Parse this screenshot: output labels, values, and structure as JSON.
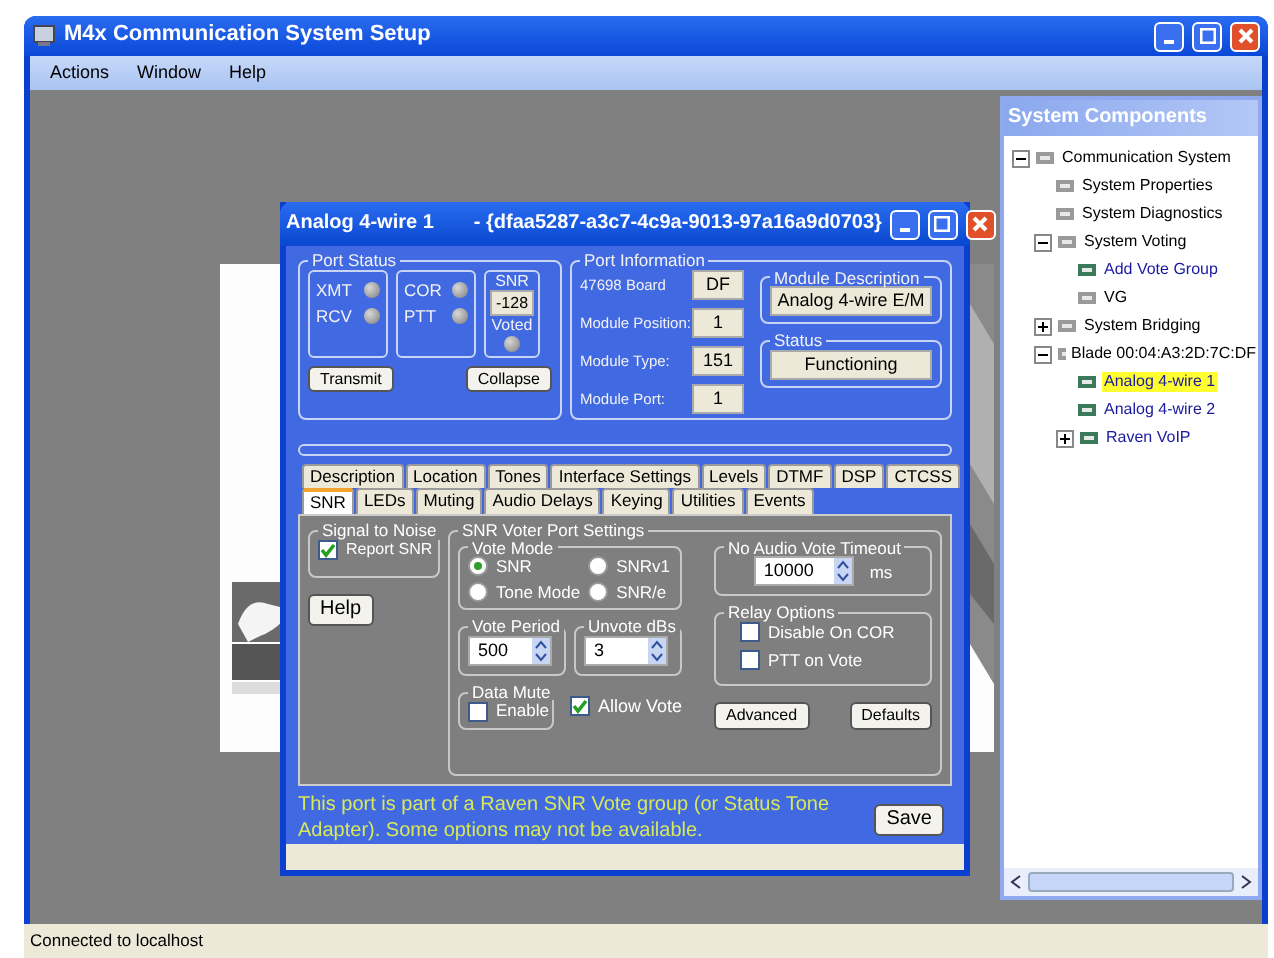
{
  "window": {
    "title": "M4x Communication System Setup"
  },
  "menu": [
    "Actions",
    "Window",
    "Help"
  ],
  "dialog": {
    "title": "Analog 4-wire 1",
    "guid": "- {dfaa5287-a3c7-4c9a-9013-97a16a9d0703}",
    "port_status": {
      "title": "Port Status",
      "indicators": [
        {
          "label": "XMT"
        },
        {
          "label": "RCV"
        },
        {
          "label": "COR"
        },
        {
          "label": "PTT"
        }
      ],
      "snr_title": "SNR",
      "snr_value": "-128",
      "voted_label": "Voted",
      "buttons": [
        "Transmit",
        "Collapse"
      ]
    },
    "port_info": {
      "title": "Port Information",
      "fields": [
        {
          "label": "47698 Board",
          "value": "DF"
        },
        {
          "label": "Module Position:",
          "value": "1"
        },
        {
          "label": "Module Type:",
          "value": "151"
        },
        {
          "label": "Module Port:",
          "value": "1"
        }
      ],
      "module_description": {
        "title": "Module Description",
        "value": "Analog 4-wire E/M"
      },
      "status": {
        "title": "Status",
        "value": "Functioning"
      }
    },
    "tab_rows": [
      {
        "tabs": [
          {
            "label": "Description",
            "selected": false
          },
          {
            "label": "Location",
            "selected": false
          },
          {
            "label": "Tones",
            "selected": false
          },
          {
            "label": "Interface Settings",
            "selected": false
          },
          {
            "label": "Levels",
            "selected": false
          },
          {
            "label": "DTMF",
            "selected": false
          },
          {
            "label": "DSP",
            "selected": false
          },
          {
            "label": "CTCSS",
            "selected": false
          }
        ]
      },
      {
        "tabs": [
          {
            "label": "SNR",
            "selected": true
          },
          {
            "label": "LEDs",
            "selected": false
          },
          {
            "label": "Muting",
            "selected": false
          },
          {
            "label": "Audio Delays",
            "selected": false
          },
          {
            "label": "Keying",
            "selected": false
          },
          {
            "label": "Utilities",
            "selected": false
          },
          {
            "label": "Events",
            "selected": false
          }
        ]
      }
    ],
    "snr_tab": {
      "signal_to_noise": {
        "title": "Signal to Noise",
        "report_snr": {
          "label": "Report SNR",
          "checked": true
        }
      },
      "help_button": "Help",
      "voter": {
        "title": "SNR Voter Port Settings",
        "vote_mode": {
          "title": "Vote Mode",
          "options": [
            {
              "label": "SNR",
              "selected": true
            },
            {
              "label": "SNRv1",
              "selected": false
            },
            {
              "label": "Tone Mode",
              "selected": false
            },
            {
              "label": "SNR/e",
              "selected": false
            }
          ]
        },
        "vote_period": {
          "title": "Vote Period",
          "value": "500"
        },
        "unvote": {
          "title": "Unvote dBs",
          "value": "3"
        },
        "data_mute": {
          "title": "Data Mute",
          "enable": {
            "label": "Enable",
            "checked": false
          }
        },
        "allow_vote": {
          "label": "Allow Vote",
          "checked": true
        },
        "timeout": {
          "title": "No Audio Vote Timeout",
          "value": "10000",
          "unit": "ms"
        },
        "relay": {
          "title": "Relay Options",
          "options": [
            {
              "label": "Disable On COR",
              "checked": false
            },
            {
              "label": "PTT on Vote",
              "checked": false
            }
          ]
        },
        "buttons": [
          "Advanced",
          "Defaults"
        ]
      }
    },
    "note": "This port is part of a Raven SNR Vote group (or Status Tone Adapter).  Some options may not be available.",
    "save_button": "Save"
  },
  "sidebar": {
    "title": "System Components",
    "tree": [
      {
        "label": "Communication System",
        "kind": "node",
        "selected": false,
        "expanded": true,
        "children": [
          {
            "label": "System Properties",
            "kind": "node",
            "selected": false
          },
          {
            "label": "System Diagnostics",
            "kind": "node",
            "selected": false
          },
          {
            "label": "System Voting",
            "kind": "node",
            "selected": false,
            "expanded": true,
            "children": [
              {
                "label": "Add Vote Group",
                "kind": "link",
                "selected": false
              },
              {
                "label": "VG",
                "kind": "node",
                "selected": false
              }
            ]
          },
          {
            "label": "System Bridging",
            "kind": "node",
            "selected": false,
            "expanded": false
          },
          {
            "label": "Blade 00:04:A3:2D:7C:DF",
            "kind": "node",
            "selected": false,
            "expanded": true,
            "children": [
              {
                "label": "Analog 4-wire 1",
                "kind": "link",
                "selected": true
              },
              {
                "label": "Analog 4-wire 2",
                "kind": "link",
                "selected": false
              },
              {
                "label": "Raven VoIP",
                "kind": "link",
                "selected": false,
                "expanded": false
              }
            ]
          }
        ]
      }
    ]
  },
  "status_bar": "Connected to localhost"
}
